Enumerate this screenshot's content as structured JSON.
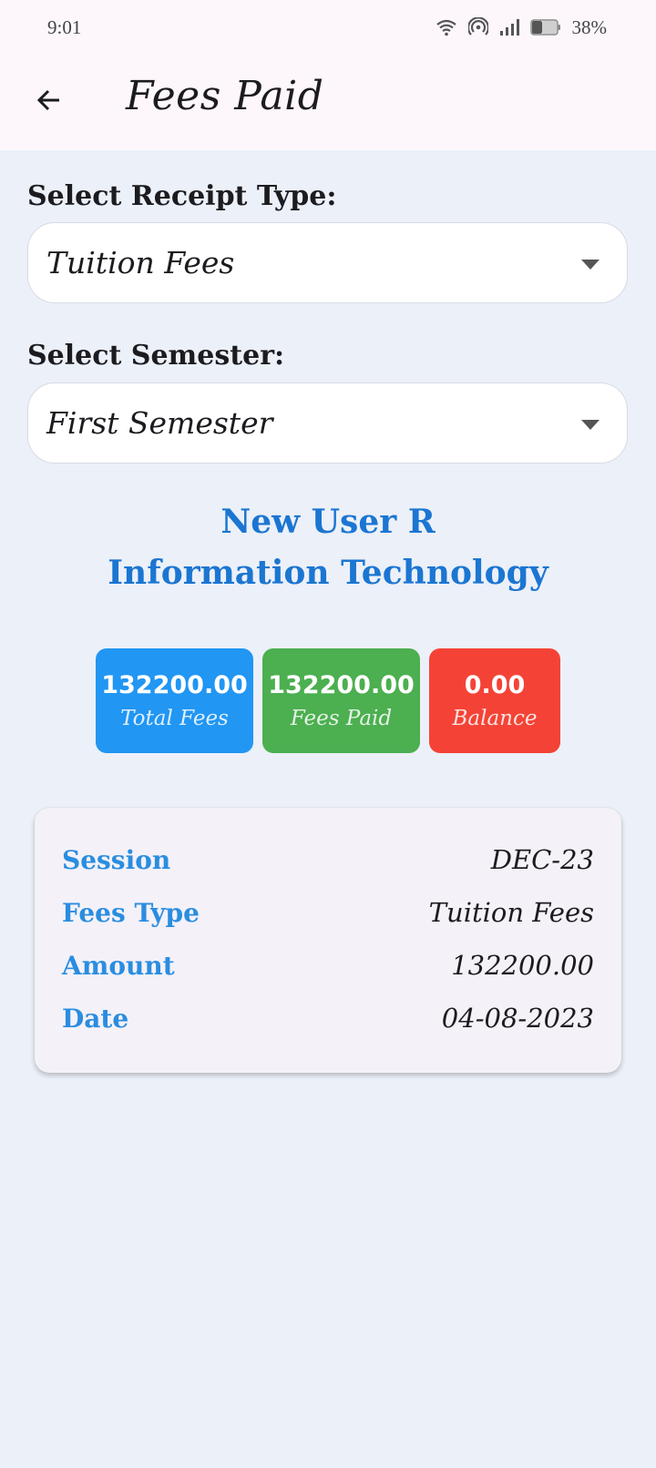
{
  "status_bar": {
    "time": "9:01",
    "battery": "38%",
    "icons": [
      "wifi-icon",
      "hotspot-icon",
      "signal-icon",
      "battery-icon"
    ]
  },
  "app_bar": {
    "title": "Fees Paid",
    "back_icon": "arrow-back-icon"
  },
  "receipt_type": {
    "label": "Select Receipt Type:",
    "selected": "Tuition Fees"
  },
  "semester": {
    "label": "Select Semester:",
    "selected": "First Semester"
  },
  "user": {
    "name": "New User R",
    "department": "Information Technology"
  },
  "summary": {
    "total": {
      "value": "132200.00",
      "label": "Total Fees",
      "color": "#2196f3"
    },
    "paid": {
      "value": "132200.00",
      "label": "Fees Paid",
      "color": "#4caf50"
    },
    "balance": {
      "value": "0.00",
      "label": "Balance",
      "color": "#f44336"
    }
  },
  "receipt": {
    "rows": [
      {
        "key": "Session",
        "value": "DEC-23"
      },
      {
        "key": "Fees Type",
        "value": "Tuition Fees"
      },
      {
        "key": "Amount",
        "value": "132200.00"
      },
      {
        "key": "Date",
        "value": "04-08-2023"
      }
    ]
  },
  "colors": {
    "accent": "#1b76d2",
    "background": "#ecf0f8",
    "appbar": "#fdf7fc"
  }
}
